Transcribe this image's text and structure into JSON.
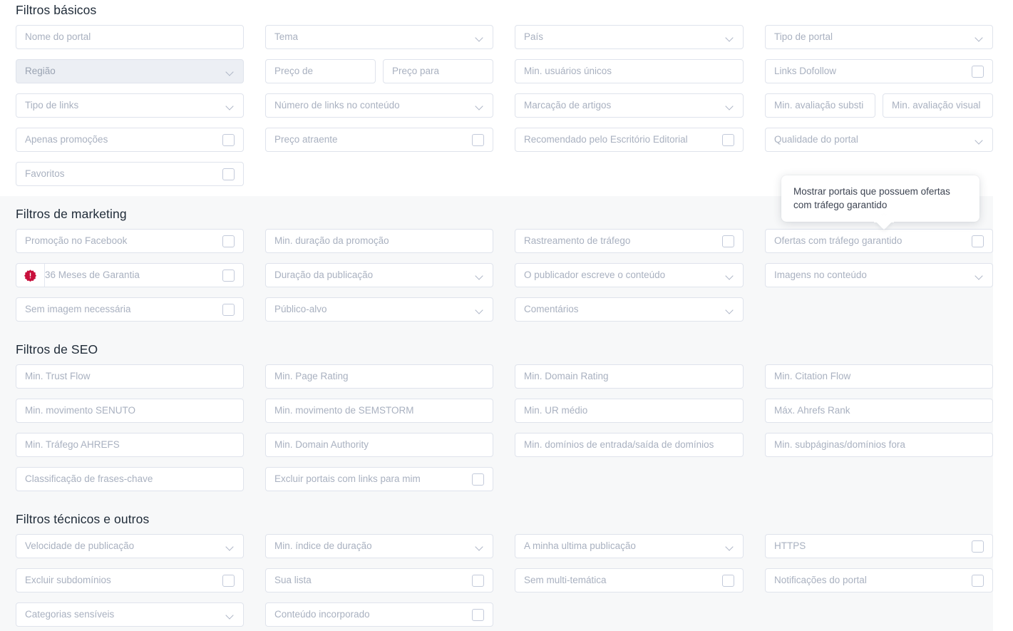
{
  "colors": {
    "page_background": "#ffffff",
    "section_alt_background": "#f7f8f9",
    "field_border": "#dfe3ec",
    "placeholder_text": "#a9b1c0",
    "title_text": "#202c39",
    "badge_red": "#c8103c",
    "checkbox_border": "#c3cada"
  },
  "tooltip": {
    "text": "Mostrar portais que possuem ofertas com tráfego garantido"
  },
  "sections": [
    {
      "id": "basic-filters",
      "title": "Filtros básicos",
      "rows": [
        [
          {
            "kind": "text",
            "name": "portal-name",
            "placeholder": "Nome do portal"
          },
          {
            "kind": "select",
            "name": "theme",
            "placeholder": "Tema"
          },
          {
            "kind": "select",
            "name": "country",
            "placeholder": "País"
          },
          {
            "kind": "select",
            "name": "portal-type",
            "placeholder": "Tipo de portal"
          }
        ],
        [
          {
            "kind": "select",
            "name": "region",
            "placeholder": "Região",
            "disabled": true
          },
          {
            "kind": "pair",
            "name": "price-range",
            "fields": [
              {
                "kind": "text",
                "name": "price-from",
                "placeholder": "Preço de"
              },
              {
                "kind": "text",
                "name": "price-to",
                "placeholder": "Preço para"
              }
            ]
          },
          {
            "kind": "text",
            "name": "min-unique-users",
            "placeholder": "Min. usuários únicos"
          },
          {
            "kind": "checkbox",
            "name": "dofollow-links",
            "placeholder": "Links Dofollow"
          }
        ],
        [
          {
            "kind": "select",
            "name": "link-type",
            "placeholder": "Tipo de links"
          },
          {
            "kind": "select",
            "name": "links-in-content-count",
            "placeholder": "Número de links no conteúdo"
          },
          {
            "kind": "select",
            "name": "article-marking",
            "placeholder": "Marcação de artigos"
          },
          {
            "kind": "pair",
            "name": "min-ratings",
            "fields": [
              {
                "kind": "text",
                "name": "min-substantive-rating",
                "placeholder": "Min. avaliação substi"
              },
              {
                "kind": "text",
                "name": "min-visual-rating",
                "placeholder": "Min. avaliação visual"
              }
            ]
          }
        ],
        [
          {
            "kind": "checkbox",
            "name": "promotions-only",
            "placeholder": "Apenas promoções"
          },
          {
            "kind": "checkbox",
            "name": "attractive-price",
            "placeholder": "Preço atraente"
          },
          {
            "kind": "checkbox",
            "name": "recommended-by-editorial-office",
            "placeholder": "Recomendado pelo Escritório Editorial"
          },
          {
            "kind": "select",
            "name": "portal-quality",
            "placeholder": "Qualidade do portal"
          }
        ],
        [
          {
            "kind": "checkbox",
            "name": "favorites",
            "placeholder": "Favoritos"
          },
          {
            "kind": "empty"
          },
          {
            "kind": "empty"
          },
          {
            "kind": "empty"
          }
        ]
      ]
    },
    {
      "id": "marketing-filters",
      "title": "Filtros de marketing",
      "alt": true,
      "rows": [
        [
          {
            "kind": "checkbox",
            "name": "facebook-promotion",
            "placeholder": "Promoção no Facebook"
          },
          {
            "kind": "text",
            "name": "min-promotion-duration",
            "placeholder": "Min. duração da promoção"
          },
          {
            "kind": "checkbox",
            "name": "traffic-tracking",
            "placeholder": "Rastreamento de tráfego"
          },
          {
            "kind": "checkbox",
            "name": "guaranteed-traffic-offers",
            "placeholder": "Ofertas com tráfego garantido"
          }
        ],
        [
          {
            "kind": "checkbox",
            "name": "36-months-warranty",
            "placeholder": "36 Meses de Garantia",
            "badge": "warning-badge-icon"
          },
          {
            "kind": "select",
            "name": "publication-duration",
            "placeholder": "Duração da publicação"
          },
          {
            "kind": "select",
            "name": "publisher-writes-content",
            "placeholder": "O publicador escreve o conteúdo"
          },
          {
            "kind": "select",
            "name": "images-in-content",
            "placeholder": "Imagens no conteúdo"
          }
        ],
        [
          {
            "kind": "checkbox",
            "name": "no-image-required",
            "placeholder": "Sem imagem necessária"
          },
          {
            "kind": "select",
            "name": "target-audience",
            "placeholder": "Público-alvo"
          },
          {
            "kind": "select",
            "name": "comments",
            "placeholder": "Comentários"
          },
          {
            "kind": "empty"
          }
        ]
      ]
    },
    {
      "id": "seo-filters",
      "title": "Filtros de SEO",
      "alt": true,
      "rows": [
        [
          {
            "kind": "text",
            "name": "min-trust-flow",
            "placeholder": "Min. Trust Flow"
          },
          {
            "kind": "text",
            "name": "min-page-rating",
            "placeholder": "Min. Page Rating"
          },
          {
            "kind": "text",
            "name": "min-domain-rating",
            "placeholder": "Min. Domain Rating"
          },
          {
            "kind": "text",
            "name": "min-citation-flow",
            "placeholder": "Min. Citation Flow"
          }
        ],
        [
          {
            "kind": "text",
            "name": "min-senuto-movement",
            "placeholder": "Min. movimento SENUTO"
          },
          {
            "kind": "text",
            "name": "min-semstorm-movement",
            "placeholder": "Min. movimento de SEMSTORM"
          },
          {
            "kind": "text",
            "name": "min-average-ur",
            "placeholder": "Min. UR médio"
          },
          {
            "kind": "text",
            "name": "max-ahrefs-rank",
            "placeholder": "Máx. Ahrefs Rank"
          }
        ],
        [
          {
            "kind": "text",
            "name": "min-ahrefs-traffic",
            "placeholder": "Min. Tráfego AHREFS"
          },
          {
            "kind": "text",
            "name": "min-domain-authority",
            "placeholder": "Min. Domain Authority"
          },
          {
            "kind": "text",
            "name": "min-in-out-domains",
            "placeholder": "Min. domínios de entrada/saída de domínios"
          },
          {
            "kind": "text",
            "name": "min-subpages-out-domains",
            "placeholder": "Min. subpáginas/domínios fora"
          }
        ],
        [
          {
            "kind": "text",
            "name": "keyphrase-classification",
            "placeholder": "Classificação de frases-chave"
          },
          {
            "kind": "checkbox",
            "name": "exclude-portals-linking-to-me",
            "placeholder": "Excluir portais com links para mim"
          },
          {
            "kind": "empty"
          },
          {
            "kind": "empty"
          }
        ]
      ]
    },
    {
      "id": "technical-filters",
      "title": "Filtros técnicos e outros",
      "alt": true,
      "rows": [
        [
          {
            "kind": "select",
            "name": "publication-speed",
            "placeholder": "Velocidade de publicação"
          },
          {
            "kind": "select",
            "name": "min-duration-index",
            "placeholder": "Min. índice de duração"
          },
          {
            "kind": "select",
            "name": "my-last-publication",
            "placeholder": "A minha ultima publicação"
          },
          {
            "kind": "checkbox",
            "name": "https",
            "placeholder": "HTTPS"
          }
        ],
        [
          {
            "kind": "checkbox",
            "name": "exclude-subdomains",
            "placeholder": "Excluir subdomínios"
          },
          {
            "kind": "checkbox",
            "name": "your-list",
            "placeholder": "Sua lista"
          },
          {
            "kind": "checkbox",
            "name": "no-multi-thematic",
            "placeholder": "Sem multi-temática"
          },
          {
            "kind": "checkbox",
            "name": "portal-notifications",
            "placeholder": "Notificações do portal"
          }
        ],
        [
          {
            "kind": "select",
            "name": "sensitive-categories",
            "placeholder": "Categorias sensíveis"
          },
          {
            "kind": "checkbox",
            "name": "embedded-content",
            "placeholder": "Conteúdo incorporado"
          },
          {
            "kind": "empty"
          },
          {
            "kind": "empty"
          }
        ]
      ]
    }
  ]
}
